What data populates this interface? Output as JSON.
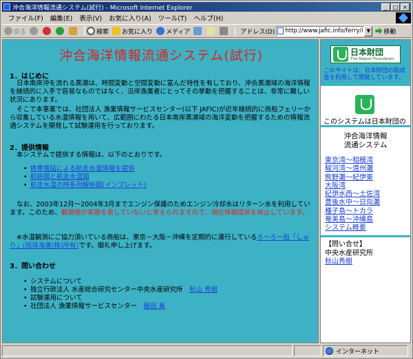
{
  "window": {
    "title": "沖合海洋情報流通システム(試行) - Microsoft Internet Explorer",
    "min_btn": "_",
    "max_btn": "□",
    "close_btn": "×"
  },
  "menu": [
    "ファイル(F)",
    "編集(E)",
    "表示(V)",
    "お気に入り(A)",
    "ツール(T)",
    "ヘルプ(H)"
  ],
  "toolbar": {
    "back": "戻る",
    "search": "検索",
    "favorites": "お気に入り",
    "media": "メディア",
    "address_label": "アドレス(D)",
    "address_value": "http://www.jafic.info/ferry/inde",
    "go": "移動"
  },
  "main": {
    "title": "沖合海洋情報流通システム(試行)",
    "s1_head": "1．はじめに",
    "s1_p1": "日本南岸沖を流れる黒潮は、時間変動と空間変動に富んだ特性を有しており、沖合黒潮域の海洋情報を継続的に入手で容易なものではなく、沿岸漁業者にとってその挙動を把握することは、非常に難しい状況にあります。",
    "s1_p2": "そこで本事業では、社団法人 漁業情報サービスセンター(以下 JAFIC)が近年継続的に商船フェリーから収集している水温情報を用いて、広範囲にわたる日本南岸黒潮域の海洋変動を把握するための情報流通システムを開発して試験運用を行っております。",
    "s2_head": "2．提供情報",
    "s2_intro": "本システムで提供する情報は、以下のとおりです。",
    "s2_links": [
      "携帯電話による航走水温情報を提供",
      "航跡図と航走水温図",
      "航走水温の時系列解析図(インプレット)"
    ],
    "s2_note1": "なお、2003年12月～2004年3月までエンジン保護のためエンジン冷却水はリターン水を利用しています。このため、",
    "s2_note_red": "観測値が実態を表していないと考えられますので、現在情報提供を休止しています。",
    "s2_note2": "※水温観測にご協力頂いている商船は、東京－大阪－沖縄を定期的に運行している",
    "s2_note_link": "ろーろー船「しゅり」(琉球海運(株)所有)",
    "s2_note3": "です。御礼申し上げます。",
    "s3_head": "3．問い合わせ",
    "s3_items": [
      {
        "label": "システムについて",
        "org": "独立行政法人 水産総合研究センター中央水産研究所",
        "person": "秋山 秀樹"
      },
      {
        "label": "試験運用について",
        "org": "社団法人 漁業情報サービスセンター",
        "person": "藤田 真"
      }
    ]
  },
  "sidebar": {
    "logo_jp": "日本財団",
    "logo_en": "The Nippon Foundation",
    "note": "このサイトは、日本財団の助成金を利用して開発しています。",
    "caption": "このシステムは日本財団の",
    "system_title_1": "沖合海洋情報",
    "system_title_2": "流通システム",
    "links": [
      "東京湾～相模湾",
      "駿河湾～遠州灘",
      "熊野灘～紀伊東",
      "大阪湾",
      "紀伊水西～土佐湾",
      "豊後水中～日向灘",
      "種子島～トカラ",
      "奄美島～沖縄島",
      "システム概要"
    ],
    "contact_label": "【問い合せ】",
    "contact_org": "中央水産研究所",
    "contact_person": "秋山秀樹"
  },
  "status": {
    "zone": "インターネット"
  },
  "colors": {
    "page_bg": "#3db2c5",
    "title_red": "#e02020",
    "link_blue": "#1a3fd8"
  }
}
